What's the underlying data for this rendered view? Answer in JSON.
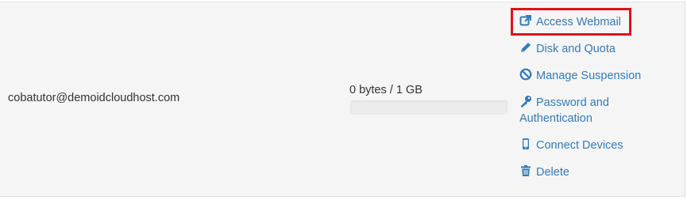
{
  "account": {
    "email": "cobatutor@demoidcloudhost.com",
    "usage_text": "0 bytes / 1 GB",
    "usage_fraction": 0
  },
  "actions": {
    "access_webmail": "Access Webmail",
    "disk_and_quota": "Disk and Quota",
    "manage_suspension": "Manage Suspension",
    "password_line1": "Password and",
    "password_line2": "Authentication",
    "connect_devices": "Connect Devices",
    "delete": "Delete"
  },
  "icons": {
    "access_webmail": "external-link-icon",
    "disk_and_quota": "pencil-icon",
    "manage_suspension": "ban-icon",
    "password": "key-icon",
    "connect_devices": "mobile-icon",
    "delete": "trash-icon"
  },
  "colors": {
    "link": "#337ab7",
    "highlight": "#e0101f",
    "row_background": "#f5f5f5"
  }
}
